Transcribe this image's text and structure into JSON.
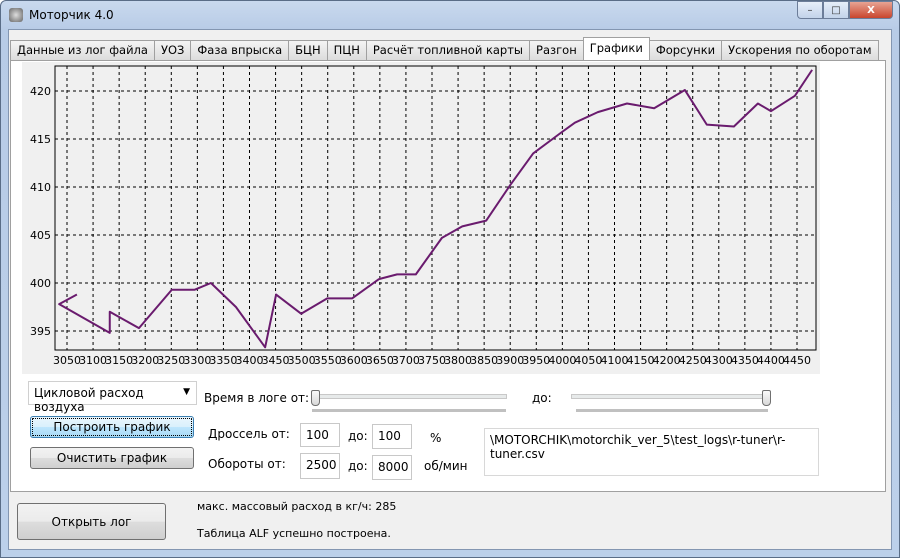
{
  "window": {
    "title": "Моторчик 4.0",
    "minimize": "–",
    "maximize": "□",
    "close": "X"
  },
  "tabs": [
    {
      "label": "Данные из лог файла"
    },
    {
      "label": "УОЗ"
    },
    {
      "label": "Фаза впрыска"
    },
    {
      "label": "БЦН"
    },
    {
      "label": "ПЦН"
    },
    {
      "label": "Расчёт топливной карты"
    },
    {
      "label": "Разгон"
    },
    {
      "label": "Графики",
      "active": true
    },
    {
      "label": "Форсунки"
    },
    {
      "label": "Ускорения по оборотам"
    }
  ],
  "chart_data": {
    "type": "line",
    "title": "",
    "xlabel": "",
    "ylabel": "",
    "xlim": [
      3027,
      4490
    ],
    "ylim": [
      392.9,
      422.6
    ],
    "x_ticks": [
      3050,
      3100,
      3150,
      3200,
      3250,
      3300,
      3350,
      3400,
      3450,
      3500,
      3550,
      3600,
      3650,
      3700,
      3750,
      3800,
      3850,
      3900,
      3950,
      4000,
      4050,
      4100,
      4150,
      4200,
      4250,
      4300,
      4350,
      4400,
      4450
    ],
    "y_ticks": [
      395,
      400,
      405,
      410,
      415,
      420
    ],
    "grid": true,
    "line_color": "#6a1b6e",
    "series": [
      {
        "name": "Цикловой расход воздуха",
        "x": [
          3069,
          3035,
          3132,
          3132,
          3188,
          3251,
          3295,
          3326,
          3374,
          3430,
          3451,
          3499,
          3549,
          3597,
          3648,
          3683,
          3719,
          3769,
          3808,
          3854,
          3900,
          3944,
          3996,
          4024,
          4068,
          4124,
          4176,
          4235,
          4277,
          4329,
          4375,
          4400,
          4446,
          4479
        ],
        "y": [
          398.8,
          397.8,
          394.8,
          397.0,
          395.3,
          399.3,
          399.3,
          400.0,
          397.5,
          393.3,
          398.8,
          396.8,
          398.4,
          398.4,
          400.4,
          400.9,
          400.9,
          404.7,
          405.9,
          406.5,
          410.2,
          413.5,
          415.6,
          416.7,
          417.8,
          418.7,
          418.2,
          420.1,
          416.5,
          416.3,
          418.7,
          417.9,
          419.5,
          422.2
        ]
      }
    ]
  },
  "controls": {
    "parameter_select": "Цикловой расход воздуха",
    "build_button": "Построить график",
    "clear_button": "Очистить график",
    "time_from_label": "Время в логе от:",
    "time_to_label": "до:",
    "time_from_slider": 0.0,
    "time_to_slider": 1.0,
    "throttle_label": "Дроссель от:",
    "throttle_from": "100",
    "throttle_to_label": "до:",
    "throttle_to": "100",
    "throttle_unit": "%",
    "rpm_label": "Обороты от:",
    "rpm_from": "2500",
    "rpm_to_label": "до:",
    "rpm_to": "8000",
    "rpm_unit": "об/мин",
    "file_path": "\\MOTORCHIK\\motorchik_ver_5\\test_logs\\r-tuner\\r-tuner.csv"
  },
  "footer": {
    "open_log_button": "Открыть лог",
    "max_flow": "макс. массовый расход в кг/ч: 285",
    "status": "Таблица ALF успешно построена."
  }
}
